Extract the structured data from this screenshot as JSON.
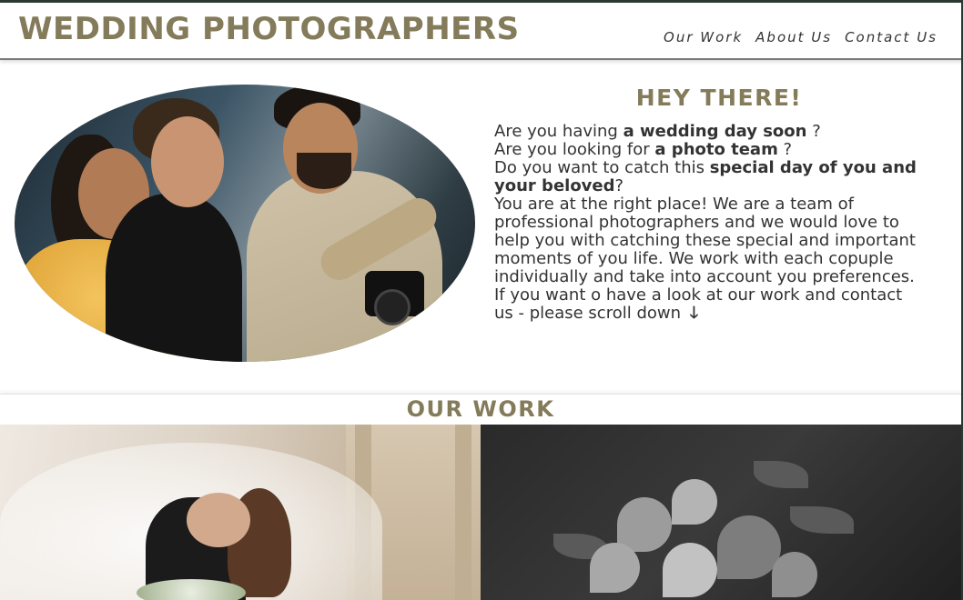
{
  "header": {
    "logo": "WEDDING PHOTOGRAPHERS",
    "nav": [
      "Our Work",
      "About Us",
      "Contact Us"
    ]
  },
  "hero": {
    "image_alt": "photographers team",
    "heading": "HEY THERE!",
    "line1_pre": "Are you having ",
    "line1_bold": "a wedding day soon",
    "line1_post": " ?",
    "line2_pre": "Are you looking for ",
    "line2_bold": "a photo team",
    "line2_post": " ?",
    "line3_pre": "Do you want to catch this ",
    "line3_bold": "special day of you and your beloved",
    "line3_post": "?",
    "paragraph": "You are at the right place! We are a team of professional photographers and we would love to help you with catching these special and important moments of you life. We work with each copuple individually and take into account you preferences.",
    "scroll_text": "If you want o have a look at our work and contact us - please scroll down",
    "scroll_arrow": "🡓"
  },
  "work": {
    "title": "OUR WORK"
  },
  "colors": {
    "accent": "#847b5a",
    "text": "#333333",
    "frame": "#2b3a30"
  }
}
